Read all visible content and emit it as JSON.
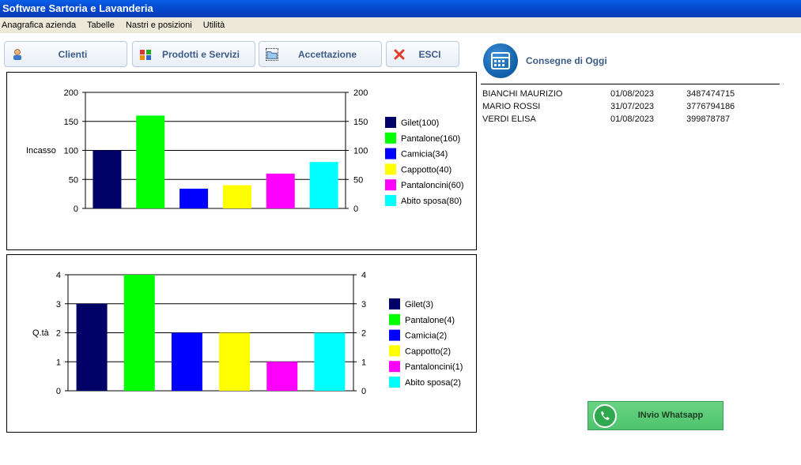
{
  "window": {
    "title": "Software Sartoria e Lavanderia"
  },
  "menu": [
    "Anagrafica azienda",
    "Tabelle",
    "Nastri e posizioni",
    "Utilità"
  ],
  "toolbar": {
    "clienti": "Clienti",
    "prodotti": "Prodotti e Servizi",
    "accettazione": "Accettazione",
    "esci": "ESCI"
  },
  "consegne": {
    "title": "Consegne di Oggi",
    "rows": [
      {
        "name": "BIANCHI MAURIZIO",
        "date": "01/08/2023",
        "phone": "3487474715"
      },
      {
        "name": "MARIO ROSSI",
        "date": "31/07/2023",
        "phone": "3776794186"
      },
      {
        "name": "VERDI ELISA",
        "date": "01/08/2023",
        "phone": "399878787"
      }
    ]
  },
  "whatsapp": {
    "label": "INvio Whatsapp"
  },
  "chart_data": [
    {
      "type": "bar",
      "ylabel": "Incasso",
      "ylim": [
        0,
        200
      ],
      "yticks": [
        0,
        50,
        100,
        150,
        200
      ],
      "categories": [
        "Gilet(100)",
        "Pantalone(160)",
        "Camicia(34)",
        "Cappotto(40)",
        "Pantaloncini(60)",
        "Abito sposa(80)"
      ],
      "values": [
        100,
        160,
        34,
        40,
        60,
        80
      ],
      "colors": [
        "#000066",
        "#00ff00",
        "#0000ff",
        "#ffff00",
        "#ff00ff",
        "#00ffff"
      ],
      "grid": true,
      "legend": "right"
    },
    {
      "type": "bar",
      "ylabel": "Q.tà",
      "ylim": [
        0,
        4
      ],
      "yticks": [
        0,
        1,
        2,
        3,
        4
      ],
      "categories": [
        "Gilet(3)",
        "Pantalone(4)",
        "Camicia(2)",
        "Cappotto(2)",
        "Pantaloncini(1)",
        "Abito sposa(2)"
      ],
      "values": [
        3,
        4,
        2,
        2,
        1,
        2
      ],
      "colors": [
        "#000066",
        "#00ff00",
        "#0000ff",
        "#ffff00",
        "#ff00ff",
        "#00ffff"
      ],
      "grid": true,
      "legend": "right"
    }
  ]
}
